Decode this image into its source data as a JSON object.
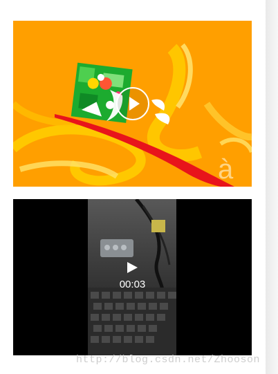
{
  "header": {
    "title": ""
  },
  "videos": [
    {
      "kind": "animated-thumbnail",
      "play_icon": "play-circle-icon"
    },
    {
      "kind": "recorded-clip",
      "play_icon": "play-triangle-icon",
      "duration": "00:03"
    }
  ],
  "watermark": {
    "text": "http://blog.csdn.net/Zhooson"
  },
  "colors": {
    "video1_bg": "#ff9f00",
    "video2_bg": "#000000",
    "accent_red": "#e8141b"
  }
}
